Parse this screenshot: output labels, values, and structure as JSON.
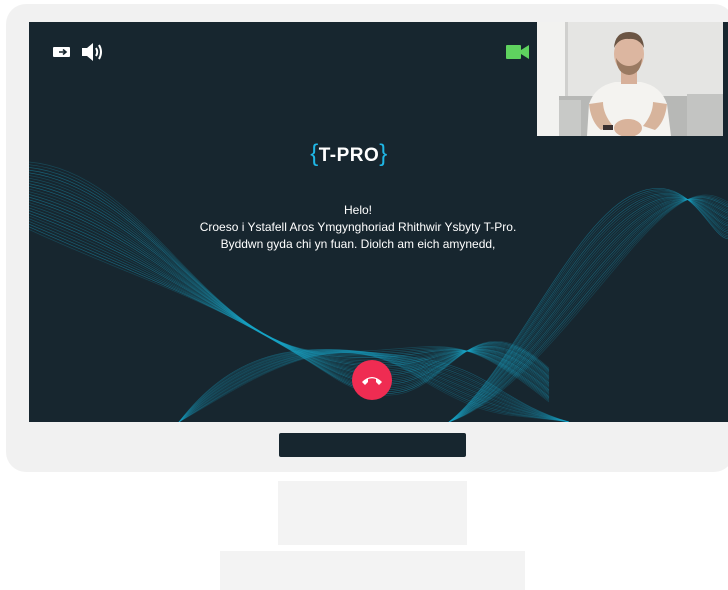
{
  "app": {
    "logo_text": "T-PRO",
    "logo_open_brace": "{",
    "logo_close_brace": "}"
  },
  "controls": {
    "exit_icon": "exit-door-icon",
    "volume_icon": "speaker-volume-icon",
    "camera_icon": "video-camera-icon",
    "hangup_icon": "phone-hangup-icon"
  },
  "message": {
    "greeting": "Helo!",
    "line1": "Croeso i Ystafell Aros Ymgynghoriad Rhithwir Ysbyty T-Pro.",
    "line2": "Byddwn gyda chi yn fuan. Diolch am eich amynedd,"
  },
  "colors": {
    "screen_bg": "#17262f",
    "accent_brace": "#1fb7e6",
    "camera_green": "#5fd25f",
    "hangup_red": "#ef2c52",
    "wave": "#1aa7c9"
  }
}
